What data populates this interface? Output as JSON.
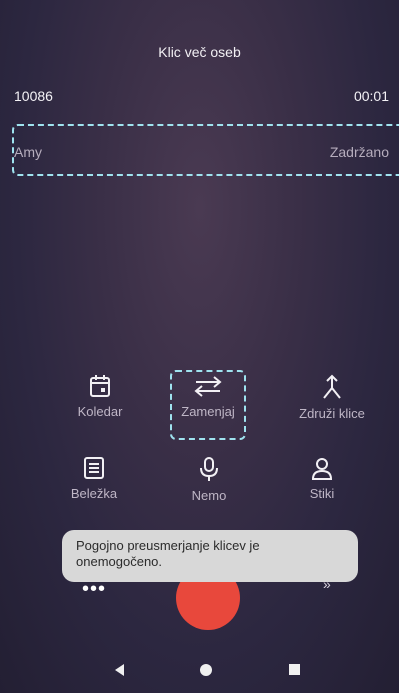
{
  "header": {
    "title": "Klic več oseb"
  },
  "call_active": {
    "number": "10086",
    "duration": "00:01"
  },
  "call_held": {
    "name": "Amy",
    "status": "Zadržano"
  },
  "actions": {
    "calendar": "Koledar",
    "swap": "Zamenjaj",
    "merge": "Združi klice",
    "notes": "Beležka",
    "mute": "Nemo",
    "contacts": "Stiki"
  },
  "toast": {
    "text": "Pogojno preusmerjanje klicev je onemogočeno."
  },
  "bottom": {
    "dots": "•••",
    "right_label": "»"
  },
  "colors": {
    "end_call": "#e8483c",
    "highlight": "#9fe3ef"
  }
}
